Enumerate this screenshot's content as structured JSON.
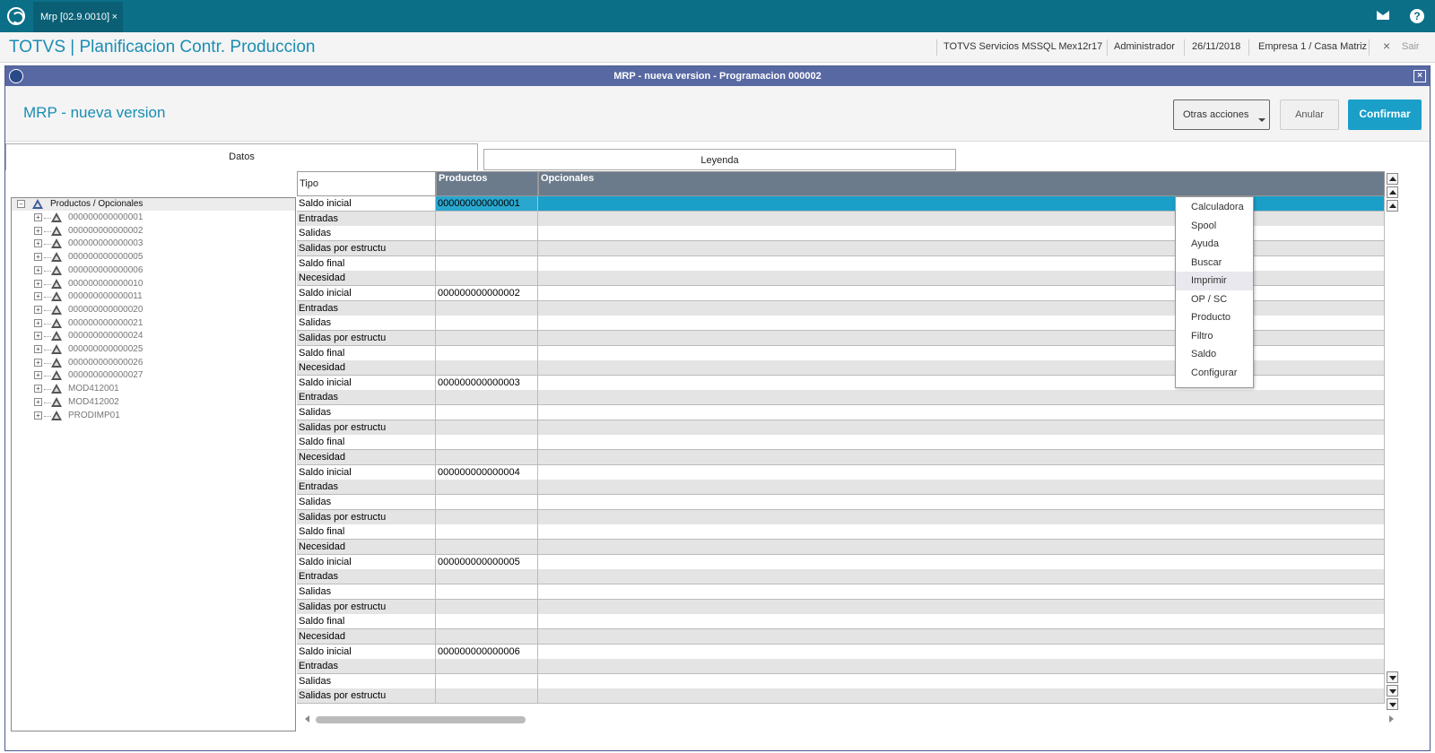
{
  "topbar": {
    "tab_label": "Mrp [02.9.0010]",
    "tab_close": "×",
    "help": "?"
  },
  "header": {
    "app_title": "TOTVS | Planificacion Contr. Produccion",
    "server": "TOTVS Servicios MSSQL Mex12r17",
    "user": "Administrador",
    "date": "26/11/2018",
    "company": "Empresa 1 / Casa Matriz",
    "exit_icon": "×",
    "exit_label": "Sair"
  },
  "dialog": {
    "title": "MRP - nueva version - Programacion 000002",
    "close": "×",
    "heading": "MRP - nueva version",
    "buttons": {
      "otras": "Otras acciones",
      "anular": "Anular",
      "confirmar": "Confirmar"
    },
    "tabs": [
      "Datos",
      "Leyenda"
    ]
  },
  "menu": {
    "items": [
      "Calculadora",
      "Spool",
      "Ayuda",
      "Buscar",
      "Imprimir",
      "OP / SC",
      "Producto",
      "Filtro",
      "Saldo",
      "Configurar"
    ],
    "highlighted_index": 4
  },
  "tree": {
    "root_box": "−",
    "child_box": "+",
    "root": "Productos / Opcionales",
    "children": [
      "000000000000001",
      "000000000000002",
      "000000000000003",
      "000000000000005",
      "000000000000006",
      "000000000000010",
      "000000000000011",
      "000000000000020",
      "000000000000021",
      "000000000000024",
      "000000000000025",
      "000000000000026",
      "000000000000027",
      "MOD412001",
      "MOD412002",
      "PRODIMP01"
    ]
  },
  "grid": {
    "columns": [
      "Tipo",
      "Productos",
      "Opcionales"
    ],
    "selected_row": 0,
    "rows": [
      {
        "tipo": "Saldo inicial",
        "producto": "000000000000001"
      },
      {
        "tipo": "Entradas",
        "producto": ""
      },
      {
        "tipo": "Salidas",
        "producto": ""
      },
      {
        "tipo": "Salidas por estructu",
        "producto": ""
      },
      {
        "tipo": "Saldo final",
        "producto": ""
      },
      {
        "tipo": "Necesidad",
        "producto": ""
      },
      {
        "tipo": "Saldo inicial",
        "producto": "000000000000002"
      },
      {
        "tipo": "Entradas",
        "producto": ""
      },
      {
        "tipo": "Salidas",
        "producto": ""
      },
      {
        "tipo": "Salidas por estructu",
        "producto": ""
      },
      {
        "tipo": "Saldo final",
        "producto": ""
      },
      {
        "tipo": "Necesidad",
        "producto": ""
      },
      {
        "tipo": "Saldo inicial",
        "producto": "000000000000003"
      },
      {
        "tipo": "Entradas",
        "producto": ""
      },
      {
        "tipo": "Salidas",
        "producto": ""
      },
      {
        "tipo": "Salidas por estructu",
        "producto": ""
      },
      {
        "tipo": "Saldo final",
        "producto": ""
      },
      {
        "tipo": "Necesidad",
        "producto": ""
      },
      {
        "tipo": "Saldo inicial",
        "producto": "000000000000004"
      },
      {
        "tipo": "Entradas",
        "producto": ""
      },
      {
        "tipo": "Salidas",
        "producto": ""
      },
      {
        "tipo": "Salidas por estructu",
        "producto": ""
      },
      {
        "tipo": "Saldo final",
        "producto": ""
      },
      {
        "tipo": "Necesidad",
        "producto": ""
      },
      {
        "tipo": "Saldo inicial",
        "producto": "000000000000005"
      },
      {
        "tipo": "Entradas",
        "producto": ""
      },
      {
        "tipo": "Salidas",
        "producto": ""
      },
      {
        "tipo": "Salidas por estructu",
        "producto": ""
      },
      {
        "tipo": "Saldo final",
        "producto": ""
      },
      {
        "tipo": "Necesidad",
        "producto": ""
      },
      {
        "tipo": "Saldo inicial",
        "producto": "000000000000006"
      },
      {
        "tipo": "Entradas",
        "producto": ""
      },
      {
        "tipo": "Salidas",
        "producto": ""
      },
      {
        "tipo": "Salidas por estructu",
        "producto": ""
      }
    ]
  },
  "colors": {
    "topbar": "#0b6f88",
    "accent": "#1a9fc9",
    "dialog_title": "#5868a3",
    "grid_header": "#6b7b8c"
  }
}
